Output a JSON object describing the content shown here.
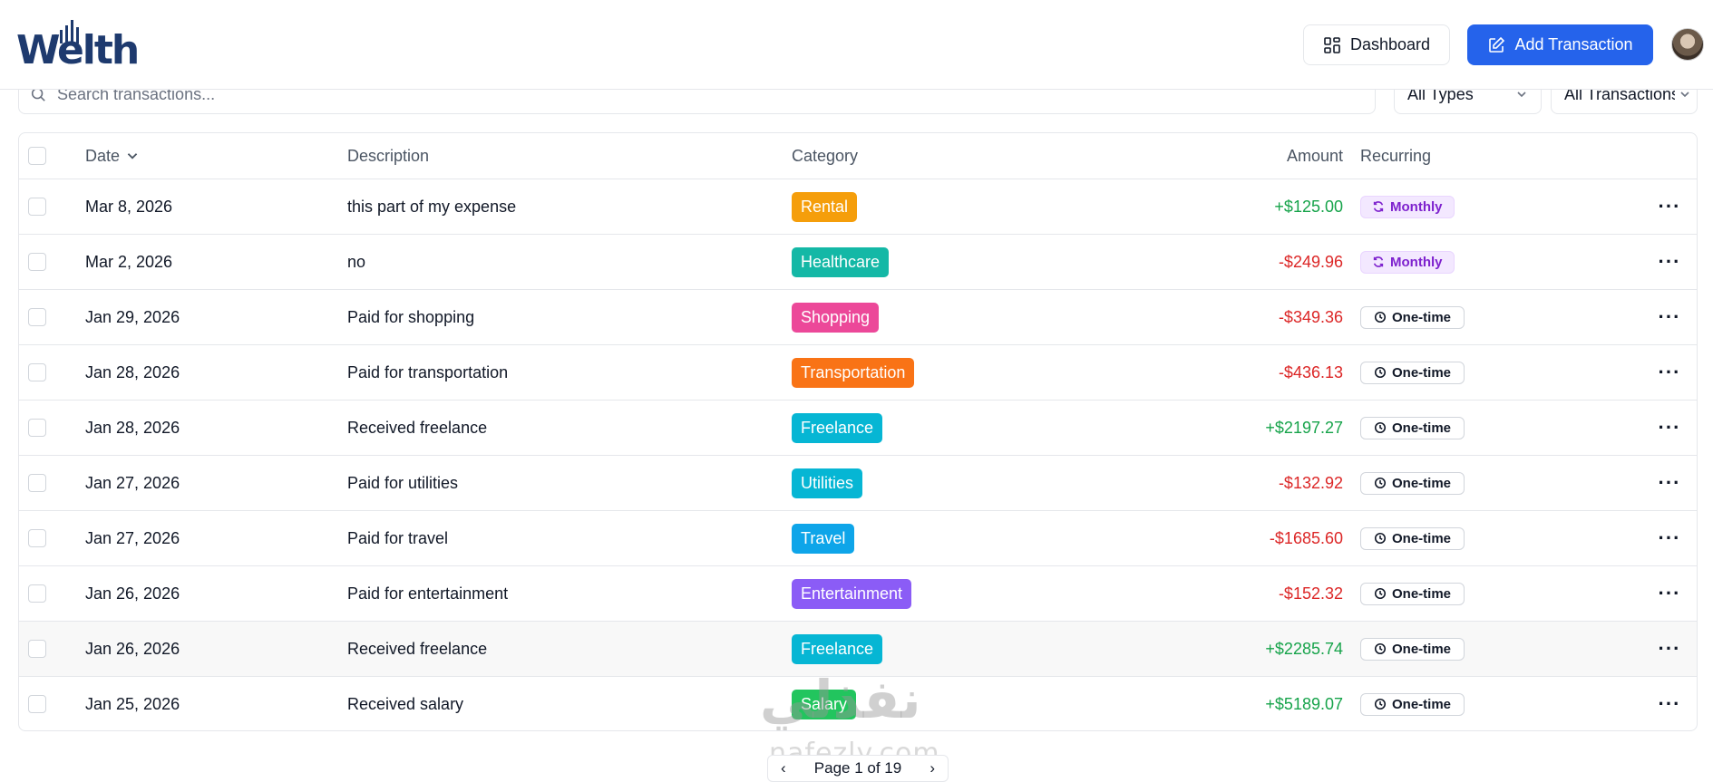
{
  "header": {
    "logo_text": "Welth",
    "dashboard_label": "Dashboard",
    "add_label": "Add Transaction"
  },
  "filters": {
    "search_placeholder": "Search transactions...",
    "type_select": "All Types",
    "recurring_select": "All Transactions"
  },
  "table": {
    "headers": {
      "date": "Date",
      "description": "Description",
      "category": "Category",
      "amount": "Amount",
      "recurring": "Recurring"
    },
    "rows": [
      {
        "date": "Mar 8, 2026",
        "description": "this part of my expense",
        "category": "Rental",
        "category_color": "#f59e0b",
        "amount": "+$125.00",
        "sign": "pos",
        "recurring": "Monthly",
        "recurring_type": "monthly"
      },
      {
        "date": "Mar 2, 2026",
        "description": "no",
        "category": "Healthcare",
        "category_color": "#14b8a6",
        "amount": "-$249.96",
        "sign": "neg",
        "recurring": "Monthly",
        "recurring_type": "monthly"
      },
      {
        "date": "Jan 29, 2026",
        "description": "Paid for shopping",
        "category": "Shopping",
        "category_color": "#ec4899",
        "amount": "-$349.36",
        "sign": "neg",
        "recurring": "One-time",
        "recurring_type": "onetime"
      },
      {
        "date": "Jan 28, 2026",
        "description": "Paid for transportation",
        "category": "Transportation",
        "category_color": "#f97316",
        "amount": "-$436.13",
        "sign": "neg",
        "recurring": "One-time",
        "recurring_type": "onetime"
      },
      {
        "date": "Jan 28, 2026",
        "description": "Received freelance",
        "category": "Freelance",
        "category_color": "#06b6d4",
        "amount": "+$2197.27",
        "sign": "pos",
        "recurring": "One-time",
        "recurring_type": "onetime"
      },
      {
        "date": "Jan 27, 2026",
        "description": "Paid for utilities",
        "category": "Utilities",
        "category_color": "#06b6d4",
        "amount": "-$132.92",
        "sign": "neg",
        "recurring": "One-time",
        "recurring_type": "onetime"
      },
      {
        "date": "Jan 27, 2026",
        "description": "Paid for travel",
        "category": "Travel",
        "category_color": "#0ea5e9",
        "amount": "-$1685.60",
        "sign": "neg",
        "recurring": "One-time",
        "recurring_type": "onetime"
      },
      {
        "date": "Jan 26, 2026",
        "description": "Paid for entertainment",
        "category": "Entertainment",
        "category_color": "#8b5cf6",
        "amount": "-$152.32",
        "sign": "neg",
        "recurring": "One-time",
        "recurring_type": "onetime"
      },
      {
        "date": "Jan 26, 2026",
        "description": "Received freelance",
        "category": "Freelance",
        "category_color": "#06b6d4",
        "amount": "+$2285.74",
        "sign": "pos",
        "recurring": "One-time",
        "recurring_type": "onetime",
        "highlight": true
      },
      {
        "date": "Jan 25, 2026",
        "description": "Received salary",
        "category": "Salary",
        "category_color": "#22c55e",
        "amount": "+$5189.07",
        "sign": "pos",
        "recurring": "One-time",
        "recurring_type": "onetime"
      }
    ]
  },
  "pagination": {
    "label": "Page 1 of 19"
  },
  "watermark": {
    "arabic": "نفذلي",
    "latin": "nafezly.com"
  },
  "colors": {
    "primary": "#2563eb",
    "positive": "#16a34a",
    "negative": "#dc2626",
    "brand": "#1e3a6e"
  },
  "icons": {
    "dashboard": "grid-icon",
    "add": "edit-icon",
    "search": "search-icon",
    "chevron": "chevron-down-icon",
    "monthly": "refresh-icon",
    "onetime": "clock-icon",
    "more": "more-horizontal-icon"
  }
}
